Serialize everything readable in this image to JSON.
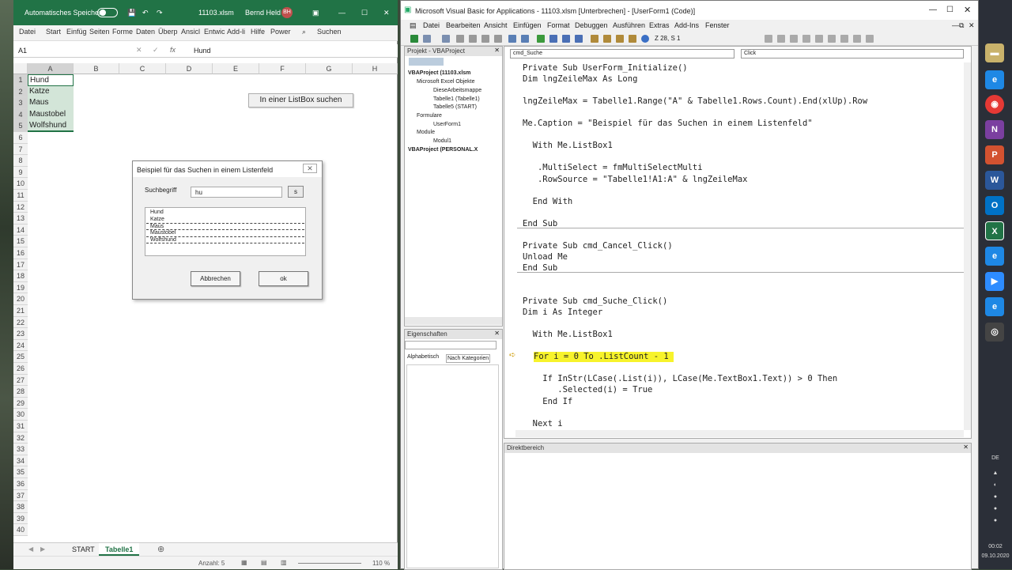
{
  "excel": {
    "autosave_label": "Automatisches Speichern",
    "filename": "11103.xlsm",
    "user": "Bernd Held",
    "user_initials": "BH",
    "menu": [
      "Datei",
      "Start",
      "Einfüg",
      "Seiten",
      "Forme",
      "Daten",
      "Überp",
      "Ansicl",
      "Entwic",
      "Add-li",
      "Hilfe",
      "Power",
      "Suchen"
    ],
    "namebox": "A1",
    "formula": "Hund",
    "columns": [
      "A",
      "B",
      "C",
      "D",
      "E",
      "F",
      "G",
      "H"
    ],
    "rows": [
      "1",
      "2",
      "3",
      "4",
      "5",
      "6",
      "7",
      "8",
      "9",
      "10",
      "11",
      "12",
      "13",
      "14",
      "15",
      "16",
      "17",
      "18",
      "19",
      "20",
      "21",
      "22",
      "23",
      "24",
      "25",
      "26",
      "27",
      "28",
      "29",
      "30",
      "31",
      "32",
      "33",
      "34",
      "35",
      "36",
      "37",
      "38",
      "39",
      "40"
    ],
    "cells_a": [
      "Hund",
      "Katze",
      "Maus",
      "Maustobel",
      "Wolfshund"
    ],
    "sheet_button": "In einer ListBox suchen",
    "tabs": [
      "START",
      "Tabelle1"
    ],
    "status_count": "Anzahl: 5",
    "zoom": "110 %"
  },
  "userform": {
    "title": "Beispiel für das Suchen in einem Listenfeld",
    "label": "Suchbegriff",
    "input_value": "hu",
    "search_btn": "s",
    "list": [
      "Hund",
      "Katze",
      "Maus",
      "Maustobel",
      "Wolfshund"
    ],
    "cancel": "Abbrechen",
    "ok": "ok"
  },
  "vba": {
    "title": "Microsoft Visual Basic for Applications - 11103.xlsm [Unterbrechen] - [UserForm1 (Code)]",
    "menu": [
      "Datei",
      "Bearbeiten",
      "Ansicht",
      "Einfügen",
      "Format",
      "Debuggen",
      "Ausführen",
      "Extras",
      "Add-Ins",
      "Fenster"
    ],
    "position": "Z 28, S 1",
    "project_title": "Projekt - VBAProject",
    "tree": [
      "VBAProject (11103.xlsm",
      "Microsoft Excel Objekte",
      "DieseArbeitsmappe",
      "Tabelle1 (Tabelle1)",
      "Tabelle5 (START)",
      "Formulare",
      "UserForm1",
      "Module",
      "Modul1",
      "VBAProject (PERSONAL.X"
    ],
    "props_title": "Eigenschaften",
    "props_tabs": [
      "Alphabetisch",
      "Nach Kategorien"
    ],
    "combo_object": "cmd_Suche",
    "combo_proc": "Click",
    "immediate_title": "Direktbereich",
    "code": [
      "Private Sub UserForm_Initialize()",
      "Dim lngZeileMax As Long",
      "",
      "lngZeileMax = Tabelle1.Range(\"A\" & Tabelle1.Rows.Count).End(xlUp).Row",
      "",
      "Me.Caption = \"Beispiel für das Suchen in einem Listenfeld\"",
      "",
      "  With Me.ListBox1",
      "",
      "   .MultiSelect = fmMultiSelectMulti",
      "   .RowSource = \"Tabelle1!A1:A\" & lngZeileMax",
      "",
      "  End With",
      "",
      "End Sub",
      "",
      "Private Sub cmd_Cancel_Click()",
      "Unload Me",
      "End Sub",
      "",
      "",
      "Private Sub cmd_Suche_Click()",
      "Dim i As Integer",
      "",
      "  With Me.ListBox1",
      "",
      "  For i = 0 To .ListCount - 1",
      "",
      "    If InStr(LCase(.List(i)), LCase(Me.TextBox1.Text)) > 0 Then",
      "       .Selected(i) = True",
      "    End If",
      "",
      "  Next i"
    ]
  },
  "taskbar": {
    "lang": "DE",
    "time": "00:02",
    "date": "09.10.2020"
  }
}
